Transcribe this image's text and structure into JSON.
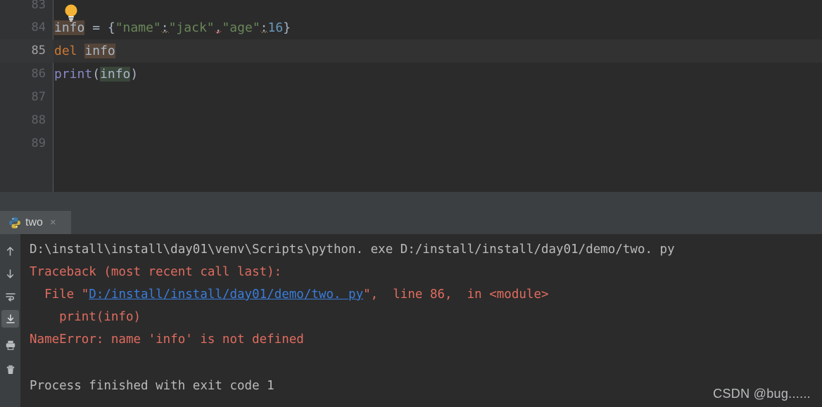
{
  "colors": {
    "editor_bg": "#2b2b2b",
    "gutter_bg": "#313335",
    "panel_bg": "#3c3f41",
    "tab_active_bg": "#4e5254",
    "current_line_bg": "#323232",
    "text_default": "#a9b7c6",
    "keyword_orange": "#cc7832",
    "string_green": "#6a8759",
    "number_blue": "#6897bb",
    "function_purple": "#8888c6",
    "console_text": "#bbbbbb",
    "error_red": "#e06c5f",
    "link_blue": "#3a7ddc"
  },
  "editor": {
    "gutter_line_numbers": [
      "83",
      "84",
      "85",
      "86",
      "87",
      "88",
      "89"
    ],
    "current_line_number": "85",
    "lines": [
      {
        "number": "83",
        "text": ""
      },
      {
        "number": "84",
        "text": "info = {\"name\":\"jack\",\"age\":16}",
        "tokens": [
          {
            "t": "info",
            "type": "plain",
            "highlight": "write"
          },
          {
            "t": " = ",
            "type": "punct"
          },
          {
            "t": "{",
            "type": "brace"
          },
          {
            "t": "\"name\"",
            "type": "string"
          },
          {
            "t": ":",
            "type": "punct"
          },
          {
            "t": "\"jack\"",
            "type": "string"
          },
          {
            "t": ",",
            "type": "punct"
          },
          {
            "t": "\"age\"",
            "type": "string"
          },
          {
            "t": ":",
            "type": "punct"
          },
          {
            "t": "16",
            "type": "number"
          },
          {
            "t": "}",
            "type": "brace"
          }
        ],
        "has_bulb": true
      },
      {
        "number": "85",
        "text": "del info",
        "tokens": [
          {
            "t": "del",
            "type": "keyword"
          },
          {
            "t": " ",
            "type": "punct"
          },
          {
            "t": "info",
            "type": "plain",
            "highlight": "write"
          }
        ]
      },
      {
        "number": "86",
        "text": "print(info)",
        "tokens": [
          {
            "t": "print",
            "type": "function"
          },
          {
            "t": "(",
            "type": "punct"
          },
          {
            "t": "info",
            "type": "plain",
            "highlight": "read"
          },
          {
            "t": ")",
            "type": "punct"
          }
        ]
      },
      {
        "number": "87",
        "text": ""
      },
      {
        "number": "88",
        "text": ""
      },
      {
        "number": "89",
        "text": ""
      }
    ]
  },
  "run_panel": {
    "tab": {
      "icon": "python-file-icon",
      "label": "two",
      "close_label": "×"
    },
    "toolbar_icons": [
      "arrow-up-icon",
      "arrow-down-icon",
      "soft-wrap-icon",
      "scroll-to-end-icon",
      "print-icon",
      "trash-icon"
    ],
    "console": {
      "command_line": "D:\\install\\install\\day01\\venv\\Scripts\\python. exe D:/install/install/day01/demo/two. py",
      "traceback_header": "Traceback (most recent call last):",
      "file_line_prefix": "  File \"",
      "file_link": "D:/install/install/day01/demo/two. py",
      "file_line_suffix": "\",  line 86,  in <module>",
      "source_line": "    print(info)",
      "error_line": "NameError: name 'info' is not defined",
      "exit_line": "Process finished with exit code 1"
    }
  },
  "watermark": {
    "text": "CSDN @bug......"
  }
}
